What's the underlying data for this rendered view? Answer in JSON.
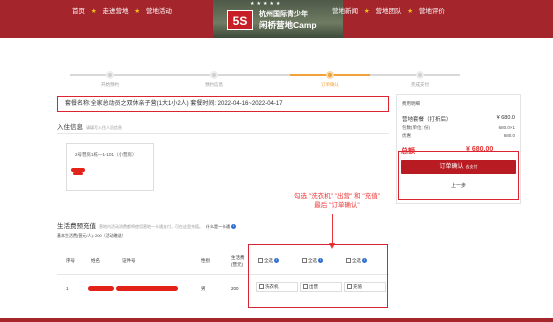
{
  "header": {
    "nav_left": [
      "首页",
      "走进营地",
      "营地活动"
    ],
    "nav_right": [
      "营地新闻",
      "营地团队",
      "营地评价"
    ],
    "logo": {
      "stars": "★★★★★",
      "badge": "5S",
      "title_line1": "杭州国际青少年",
      "title_line2": "闲桥营地Camp"
    }
  },
  "steps": [
    {
      "label": "开始预约",
      "active": false
    },
    {
      "label": "预约信息",
      "active": false
    },
    {
      "label": "订单确认",
      "active": true
    },
    {
      "label": "完成支付",
      "active": false
    }
  ],
  "order_info": "套餐名称:全家总动员之双休亲子营(1大1小2人)   套餐时间:  2022-04-16~2022-04-17",
  "guest_section": {
    "title": "入住信息",
    "subtitle": "请填写入住人员信息",
    "room_label": "2号营房1栋—1-101（小营房）"
  },
  "sidebar": {
    "title": "费用明细",
    "package_label": "营地套餐（打折后）",
    "package_value": "¥ 680.0",
    "unit_label": "包数(单位: 份)",
    "unit_value": "680.0×1",
    "discount_label": "优惠",
    "discount_value": "680.0",
    "total_label": "总额",
    "total_value": "¥ 680.00",
    "confirm_label": "订单确认",
    "confirm_small": "去支付",
    "prev_label": "上一步"
  },
  "annotation": {
    "line1": "勾选 \"洗衣机\" \"出营\" 和 \"充值\"",
    "line2": "最后 \"订单确认\""
  },
  "living_fee": {
    "title": "生活费预充值",
    "subtitle": "营地内活动消费都将使用营地一卡通支付，可在这里充值。",
    "link": "什么是一卡通",
    "base_label": "基本生活费(营元/人): 200（活动赠送）"
  },
  "table": {
    "headers": [
      "序号",
      "姓名",
      "证件号",
      "性别",
      "生活费\n(营元)"
    ],
    "select_all": [
      "全选",
      "全选",
      "全选"
    ],
    "row": {
      "index": "1",
      "gender": "男",
      "fee": "200"
    },
    "options": [
      "洗衣机",
      "出营",
      "充值"
    ]
  }
}
